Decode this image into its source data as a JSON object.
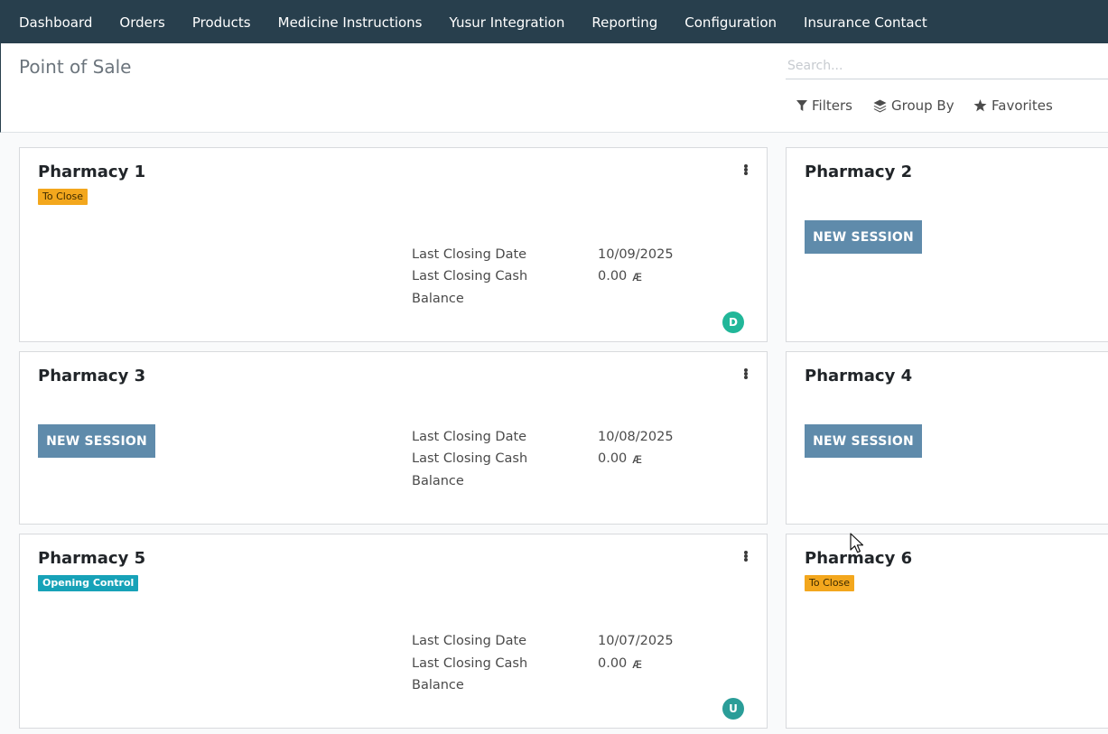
{
  "nav": {
    "items": [
      "Dashboard",
      "Orders",
      "Products",
      "Medicine Instructions",
      "Yusur Integration",
      "Reporting",
      "Configuration",
      "Insurance Contact"
    ]
  },
  "control": {
    "title": "Point of Sale",
    "search_placeholder": "Search...",
    "filters_label": "Filters",
    "group_by_label": "Group By",
    "favorites_label": "Favorites"
  },
  "labels": {
    "last_closing_date": "Last Closing Date",
    "last_closing_cash": "Last Closing Cash",
    "balance": "Balance",
    "new_session": "NEW SESSION",
    "currency_symbol": "ᴁ"
  },
  "cards": [
    {
      "name": "Pharmacy 1",
      "badge": "To Close",
      "badge_type": "warning",
      "last_closing_date": "10/09/2025",
      "last_closing_cash": "0.00",
      "avatar": "D",
      "avatar_color": "#21b799"
    },
    {
      "name": "Pharmacy 2",
      "new_session": true
    },
    {
      "name": "Pharmacy 3",
      "new_session": true,
      "last_closing_date": "10/08/2025",
      "last_closing_cash": "0.00"
    },
    {
      "name": "Pharmacy 4",
      "new_session": true
    },
    {
      "name": "Pharmacy 5",
      "badge": "Opening Control",
      "badge_type": "info",
      "last_closing_date": "10/07/2025",
      "last_closing_cash": "0.00",
      "avatar": "U",
      "avatar_color": "#2a9d98"
    },
    {
      "name": "Pharmacy 6",
      "badge": "To Close",
      "badge_type": "warning"
    }
  ],
  "colors": {
    "navbar": "#283f4d",
    "primary_button": "#5f8bab",
    "badge_warning": "#f3a71d",
    "badge_info": "#17a2b8"
  }
}
